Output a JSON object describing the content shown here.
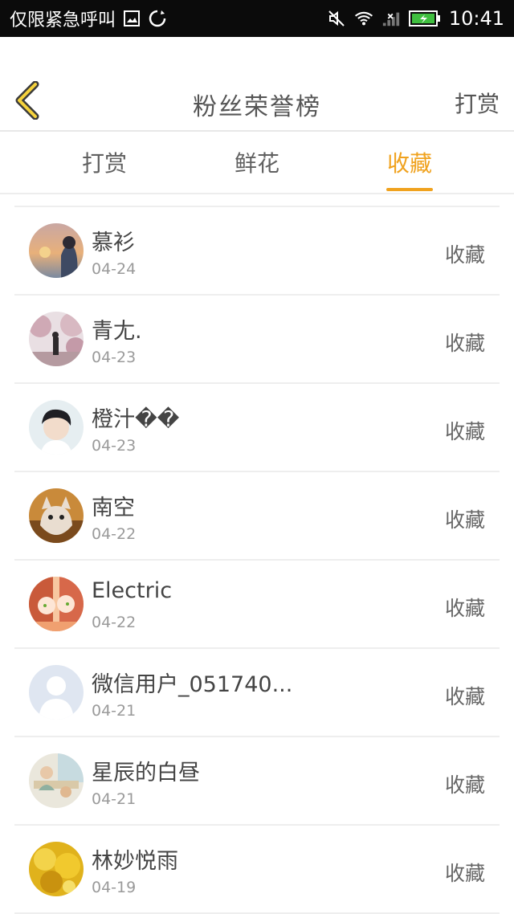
{
  "status_bar": {
    "notice": "仅限紧急呼叫",
    "time": "10:41",
    "icons": [
      "image-icon",
      "sync-icon",
      "mute-icon",
      "wifi-icon",
      "signal-icon",
      "battery-icon"
    ]
  },
  "header": {
    "title": "粉丝荣誉榜",
    "action": "打赏",
    "back_icon": "chevron-left-icon"
  },
  "tabs": [
    {
      "label": "打赏",
      "active": false
    },
    {
      "label": "鲜花",
      "active": false
    },
    {
      "label": "收藏",
      "active": true
    }
  ],
  "colors": {
    "accent": "#f0a21e",
    "text_primary": "#444444",
    "text_secondary": "#9a9a9a",
    "statusbar": "#0b0b0b"
  },
  "fans": [
    {
      "name": "慕衫",
      "date": "04-24",
      "action": "收藏"
    },
    {
      "name": "青尢.",
      "date": "04-23",
      "action": "收藏"
    },
    {
      "name": "橙汁��",
      "date": "04-23",
      "action": "收藏"
    },
    {
      "name": "南空",
      "date": "04-22",
      "action": "收藏"
    },
    {
      "name": "Electric",
      "date": "04-22",
      "action": "收藏"
    },
    {
      "name": "微信用户_051740...",
      "date": "04-21",
      "action": "收藏"
    },
    {
      "name": "星辰的白昼",
      "date": "04-21",
      "action": "收藏"
    },
    {
      "name": "林妙悦雨",
      "date": "04-19",
      "action": "收藏"
    }
  ]
}
